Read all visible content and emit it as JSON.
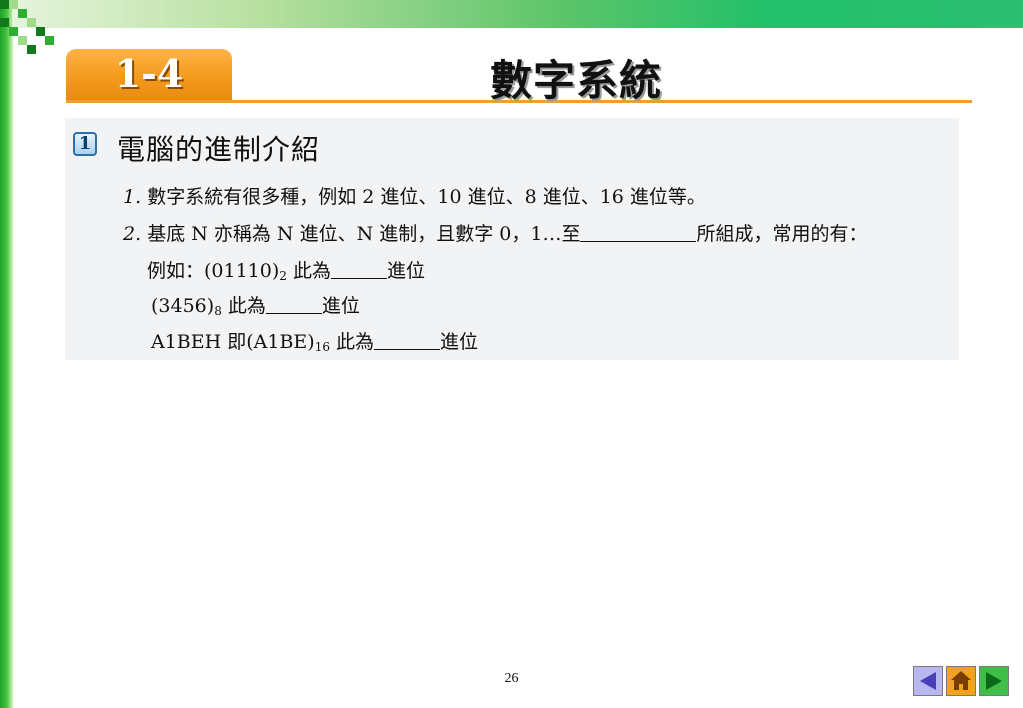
{
  "header": {
    "section_number": "1-4",
    "title": "數字系統"
  },
  "section": {
    "badge": "1",
    "heading": "電腦的進制介紹"
  },
  "content": {
    "item1": {
      "num": "1.",
      "text": "數字系統有很多種，例如 2 進位、10 進位、8 進位、16 進位等。"
    },
    "item2": {
      "num": "2.",
      "text_before": "基底 N 亦稱為 N 進位、N 進制，且數字 0，1…至",
      "text_after": "所組成，常用的有："
    },
    "example1": {
      "prefix": "例如：(01110)",
      "subscript": "2",
      "mid": " 此為",
      "suffix": "進位"
    },
    "example2": {
      "prefix": "(3456)",
      "subscript": "8",
      "mid": " 此為",
      "suffix": "進位"
    },
    "example3": {
      "prefix": "A1BEH 即(A1BE)",
      "subscript": "16",
      "mid": " 此為",
      "suffix": "進位"
    }
  },
  "footer": {
    "page_number": "26"
  },
  "nav": {
    "prev_icon": "triangle-left-icon",
    "home_icon": "home-icon",
    "next_icon": "triangle-right-icon"
  },
  "colors": {
    "accent_orange": "#f39a1c",
    "accent_green": "#2cbf72",
    "nav_prev": "#b9b7ef",
    "nav_home": "#f3a21c",
    "nav_next": "#3fbf4a"
  }
}
